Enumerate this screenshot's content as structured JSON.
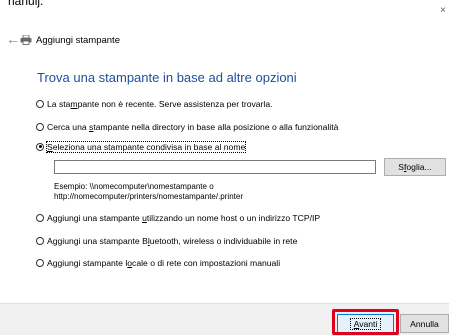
{
  "window": {
    "cut_title": "nanuij.",
    "close_glyph": "×"
  },
  "header": {
    "back_glyph": "←",
    "title": "Aggiungi stampante"
  },
  "main": {
    "heading": "Trova una stampante in base ad altre opzioni",
    "options": [
      {
        "pre": "La sta",
        "u": "m",
        "post": "pante non è recente. Serve assistenza per trovarla.",
        "checked": false
      },
      {
        "pre": "Cerca una ",
        "u": "s",
        "post": "tampante nella directory in base alla posizione o alla funzionalità",
        "checked": false
      },
      {
        "pre": "",
        "u": "S",
        "post": "eleziona una stampante condivisa in base al nome",
        "checked": true
      },
      {
        "pre": "Aggiungi una stampante ",
        "u": "u",
        "post": "tilizzando un nome host o un indirizzo TCP/IP",
        "checked": false
      },
      {
        "pre": "Aggiungi una stampante B",
        "u": "l",
        "post": "uetooth, wireless o individuabile in rete",
        "checked": false
      },
      {
        "pre": "Aggiungi stampante l",
        "u": "o",
        "post": "cale o di rete con impostazioni manuali",
        "checked": false
      }
    ],
    "name_input": {
      "value": ""
    },
    "browse": {
      "pre": "S",
      "u": "f",
      "post": "oglia..."
    },
    "example_line1": "Esempio: \\\\nomecomputer\\nomestampante o",
    "example_line2": "http://nomecomputer/printers/nomestampante/.printer"
  },
  "footer": {
    "next": {
      "pre": "",
      "u": "A",
      "post": "vanti"
    },
    "cancel": "Annulla"
  },
  "colors": {
    "heading": "#1f4f9b",
    "highlight": "#e0001b",
    "default_button_border": "#0078d7"
  }
}
